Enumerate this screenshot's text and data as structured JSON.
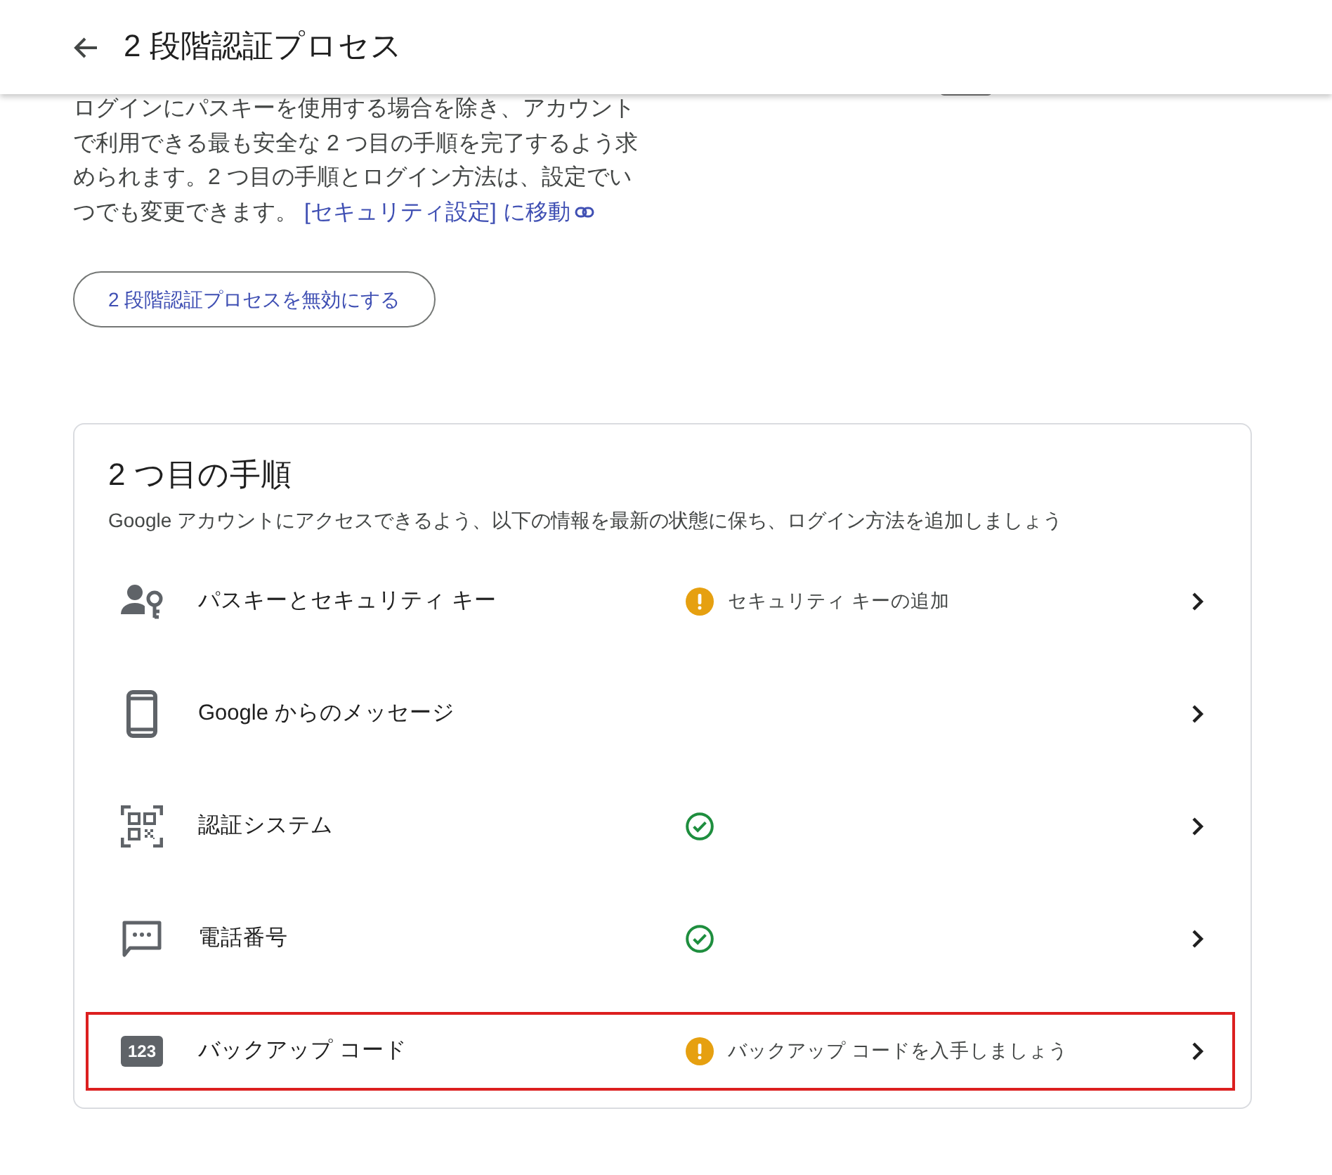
{
  "header": {
    "title": "2 段階認証プロセス"
  },
  "intro": {
    "text": "ログインにパスキーを使用する場合を除き、アカウントで利用できる最も安全な 2 つ目の手順を完了するよう求められます。2 つ目の手順とログイン方法は、設定でいつでも変更できます。",
    "link": "[セキュリティ設定] に移動"
  },
  "disable_button": {
    "label": "2 段階認証プロセスを無効にする"
  },
  "second_steps": {
    "title": "2 つ目の手順",
    "subtitle": "Google アカウントにアクセスできるよう、以下の情報を最新の状態に保ち、ログイン方法を追加しましょう",
    "steps": [
      {
        "kind": "passkey",
        "name": "パスキーとセキュリティ キー",
        "status": {
          "kind": "warning",
          "text": "セキュリティ キーの追加"
        },
        "highlighted": false
      },
      {
        "kind": "prompt",
        "name": "Google からのメッセージ",
        "highlighted": false
      },
      {
        "kind": "authenticator",
        "name": "認証システム",
        "status": {
          "kind": "done"
        },
        "highlighted": false
      },
      {
        "kind": "phone",
        "name": "電話番号",
        "status": {
          "kind": "done"
        },
        "highlighted": false
      },
      {
        "kind": "backup",
        "icon_label": "123",
        "name": "バックアップ コード",
        "status": {
          "kind": "warning",
          "text": "バックアップ コードを入手しましょう"
        },
        "highlighted": true
      }
    ]
  }
}
